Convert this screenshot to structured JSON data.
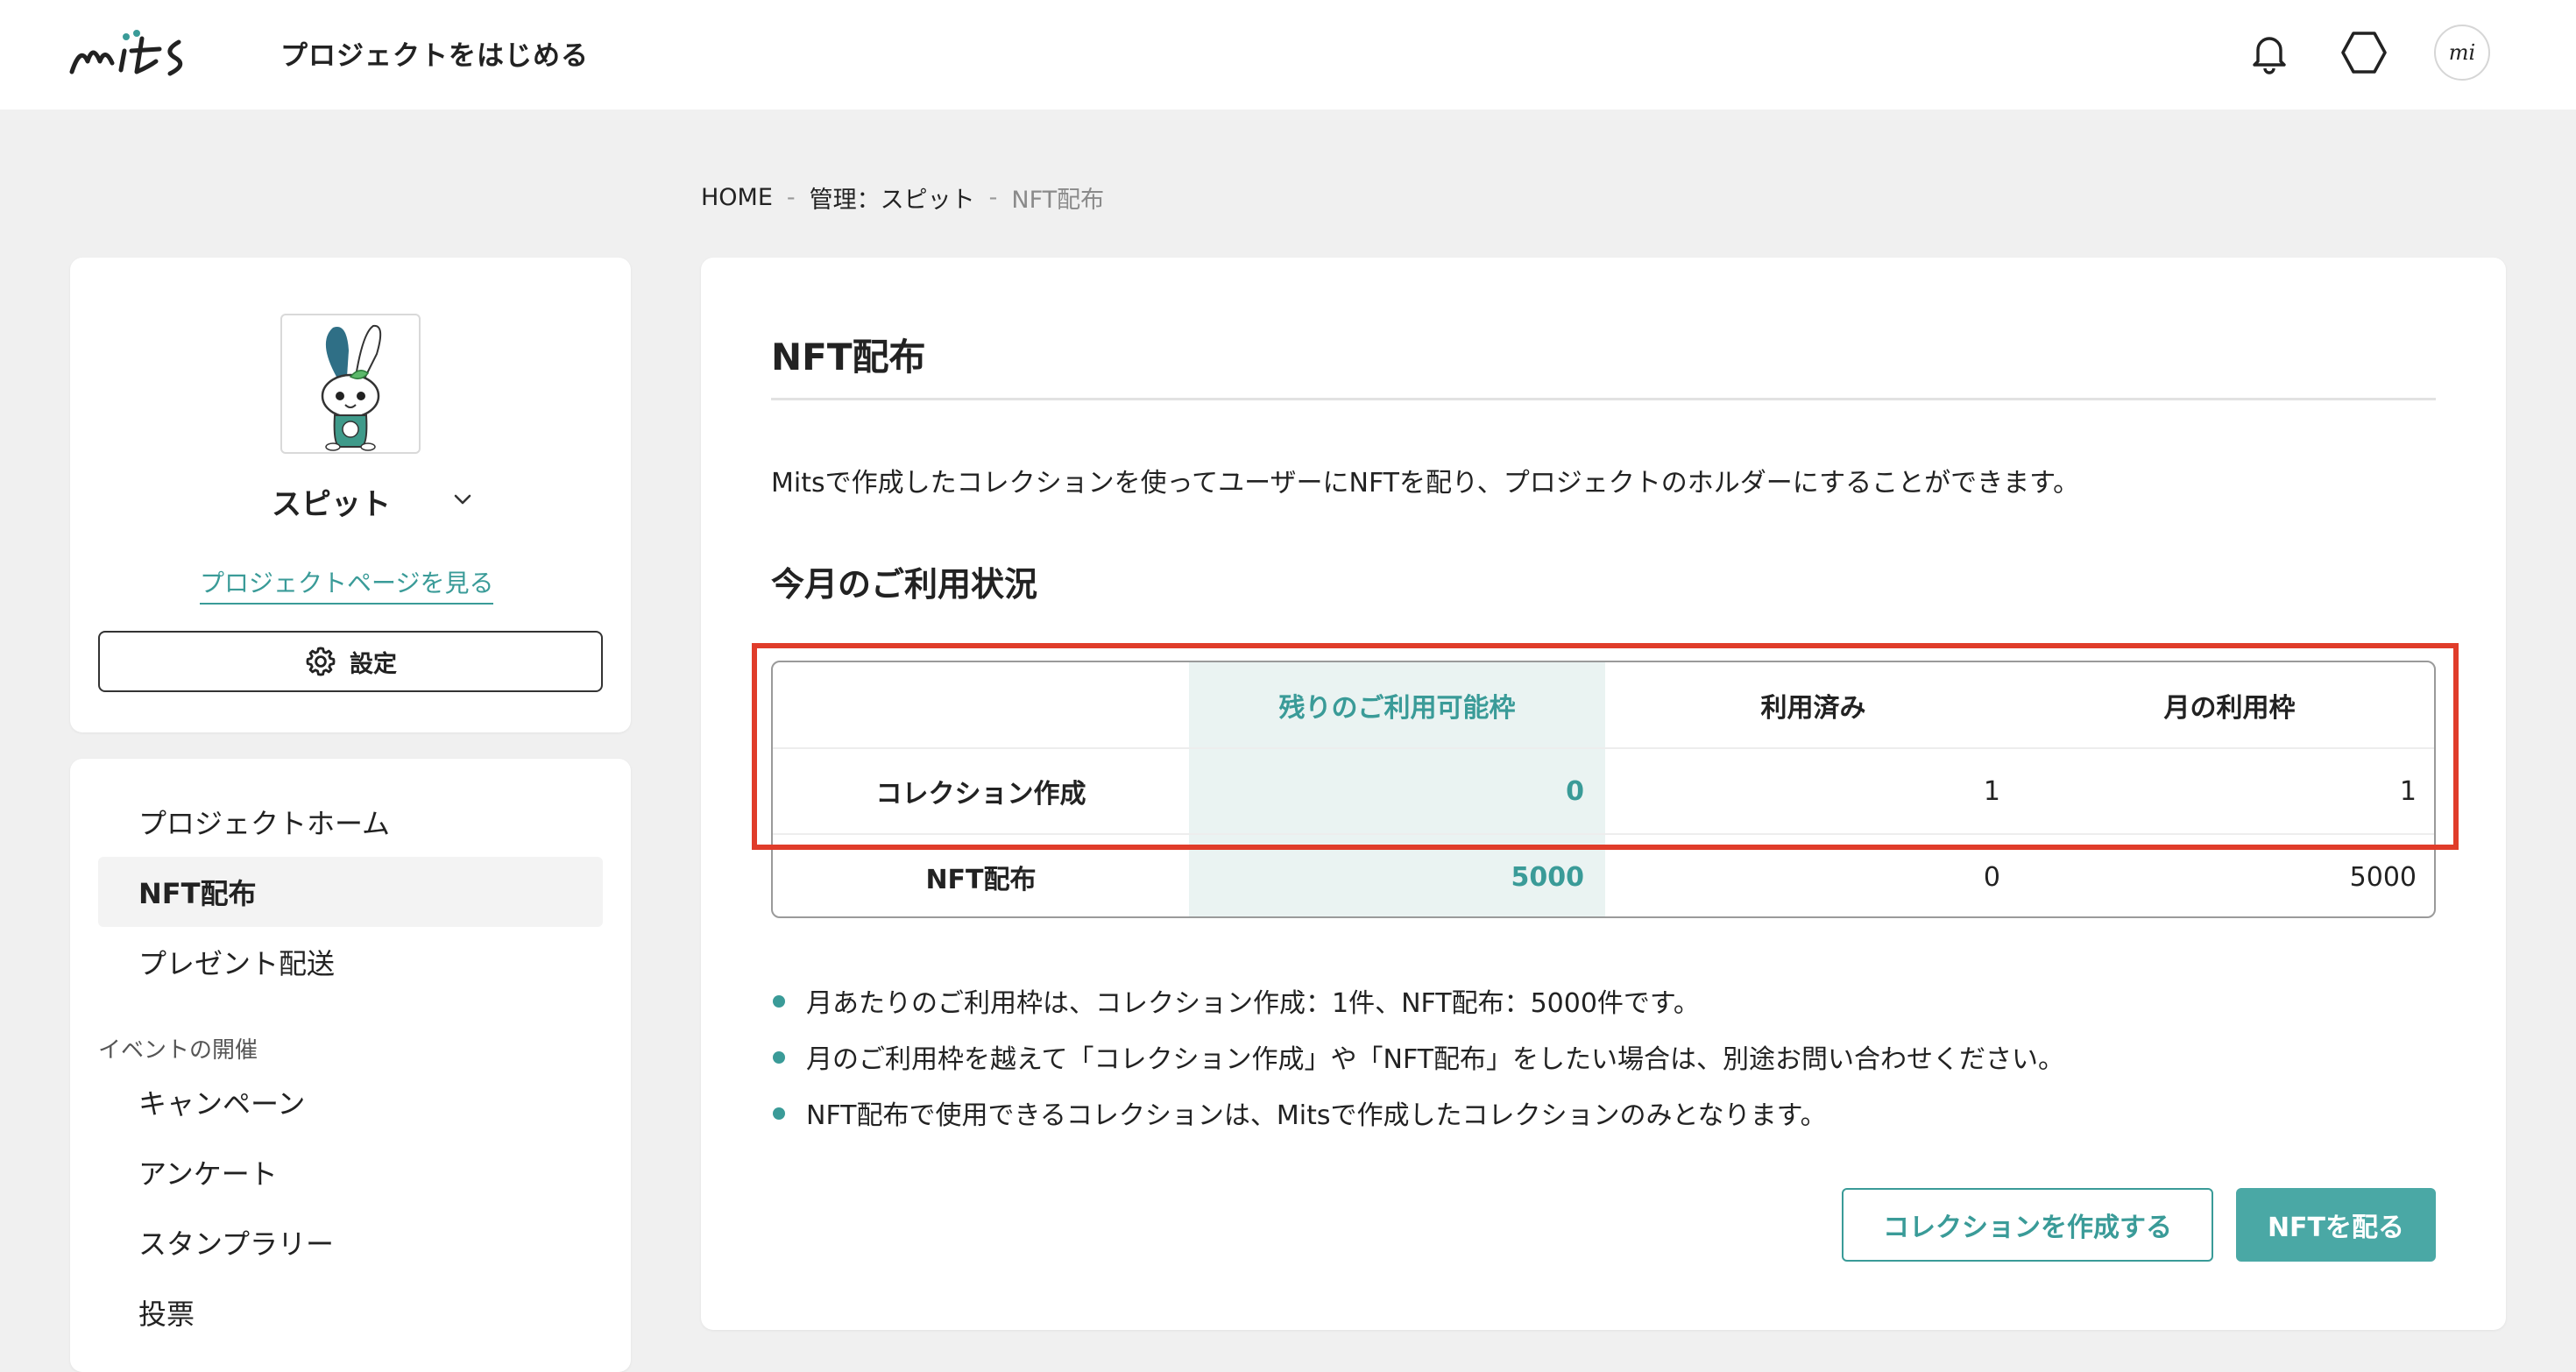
{
  "header": {
    "logo_text": "mits",
    "title": "プロジェクトをはじめる",
    "icons": [
      "bell-icon",
      "hexagon-icon",
      "user-avatar"
    ],
    "avatar_text": "mi"
  },
  "breadcrumb": {
    "items": [
      "HOME",
      "管理：スピット",
      "NFT配布"
    ],
    "separator": "-"
  },
  "sidebar": {
    "project_name": "スピット",
    "project_link": "プロジェクトページを見る",
    "settings_label": "設定",
    "nav": {
      "home": "プロジェクトホーム",
      "nft": "NFT配布",
      "present": "プレゼント配送",
      "section_events": "イベントの開催",
      "campaign": "キャンペーン",
      "survey": "アンケート",
      "stamp": "スタンプラリー",
      "vote": "投票"
    },
    "active_item": "NFT配布"
  },
  "main": {
    "title": "NFT配布",
    "description": "Mitsで作成したコレクションを使ってユーザーにNFTを配り、プロジェクトのホルダーにすることができます。",
    "usage_title": "今月のご利用状況",
    "table": {
      "columns": [
        "",
        "残りのご利用可能枠",
        "利用済み",
        "月の利用枠"
      ],
      "rows": [
        {
          "label": "コレクション作成",
          "remaining": "0",
          "used": "1",
          "limit": "1"
        },
        {
          "label": "NFT配布",
          "remaining": "5000",
          "used": "0",
          "limit": "5000"
        }
      ]
    },
    "notes": [
      "月あたりのご利用枠は、コレクション作成：1件、NFT配布：5000件です。",
      "月のご利用枠を越えて「コレクション作成」や「NFT配布」をしたい場合は、別途お問い合わせください。",
      "NFT配布で使用できるコレクションは、Mitsで作成したコレクションのみとなります。"
    ],
    "buttons": {
      "create_collection": "コレクションを作成する",
      "distribute_nft": "NFTを配る"
    }
  },
  "colors": {
    "accent": "#3a9b98",
    "button_fill": "#4aa8a5",
    "highlight_column": "#eaf3f2",
    "annotation_box": "#e03c2a",
    "page_bg": "#f0f0f0"
  }
}
